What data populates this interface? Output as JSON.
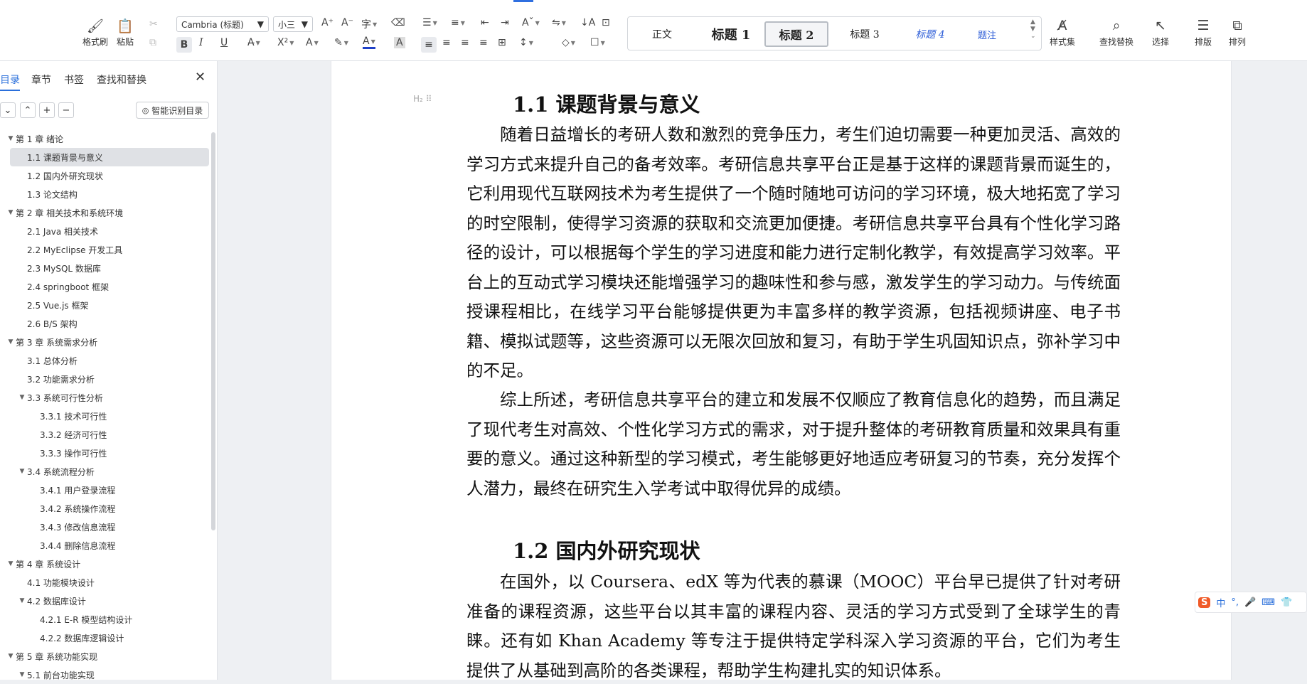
{
  "ribbon": {
    "format_painter": "格式刷",
    "paste": "粘贴",
    "font_name": "Cambria (标题)",
    "font_size": "小三",
    "styles": [
      "正文",
      "标题 1",
      "标题 2",
      "标题 3",
      "标题 4",
      "题注"
    ],
    "style_set": "样式集",
    "find_replace": "查找替换",
    "select": "选择",
    "layout": "排版",
    "arrange": "排列",
    "bold": "B",
    "italic": "I",
    "underline": "U",
    "clear": "A"
  },
  "sidebar": {
    "tabs": [
      "目录",
      "章节",
      "书签",
      "查找和替换"
    ],
    "smart_toc": "智能识别目录",
    "items": [
      {
        "label": "第 1 章  绪论",
        "level": 1,
        "toggle": "▼"
      },
      {
        "label": "1.1 课题背景与意义",
        "level": 2,
        "toggle": ""
      },
      {
        "label": "1.2 国内外研究现状",
        "level": 2,
        "toggle": ""
      },
      {
        "label": "1.3 论文结构",
        "level": 2,
        "toggle": ""
      },
      {
        "label": "第 2 章  相关技术和系统环境",
        "level": 1,
        "toggle": "▼"
      },
      {
        "label": "2.1 Java 相关技术",
        "level": 2,
        "toggle": ""
      },
      {
        "label": "2.2 MyEclipse 开发工具",
        "level": 2,
        "toggle": ""
      },
      {
        "label": "2.3 MySQL 数据库",
        "level": 2,
        "toggle": ""
      },
      {
        "label": "2.4 springboot 框架",
        "level": 2,
        "toggle": ""
      },
      {
        "label": "2.5 Vue.js 框架",
        "level": 2,
        "toggle": ""
      },
      {
        "label": "2.6 B/S 架构",
        "level": 2,
        "toggle": ""
      },
      {
        "label": "第 3 章  系统需求分析",
        "level": 1,
        "toggle": "▼"
      },
      {
        "label": "3.1 总体分析",
        "level": 2,
        "toggle": ""
      },
      {
        "label": "3.2 功能需求分析",
        "level": 2,
        "toggle": ""
      },
      {
        "label": "3.3  系统可行性分析",
        "level": 2,
        "toggle": "▼"
      },
      {
        "label": "3.3.1 技术可行性",
        "level": 3,
        "toggle": ""
      },
      {
        "label": "3.3.2 经济可行性",
        "level": 3,
        "toggle": ""
      },
      {
        "label": "3.3.3 操作可行性",
        "level": 3,
        "toggle": ""
      },
      {
        "label": "3.4 系统流程分析",
        "level": 2,
        "toggle": "▼"
      },
      {
        "label": "3.4.1  用户登录流程",
        "level": 3,
        "toggle": ""
      },
      {
        "label": "3.4.2  系统操作流程",
        "level": 3,
        "toggle": ""
      },
      {
        "label": "3.4.3 修改信息流程",
        "level": 3,
        "toggle": ""
      },
      {
        "label": "3.4.4 删除信息流程",
        "level": 3,
        "toggle": ""
      },
      {
        "label": "第 4 章  系统设计",
        "level": 1,
        "toggle": "▼"
      },
      {
        "label": "4.1  功能模块设计",
        "level": 2,
        "toggle": ""
      },
      {
        "label": "4.2  数据库设计",
        "level": 2,
        "toggle": "▼"
      },
      {
        "label": "4.2.1 E-R 模型结构设计",
        "level": 3,
        "toggle": ""
      },
      {
        "label": "4.2.2  数据库逻辑设计",
        "level": 3,
        "toggle": ""
      },
      {
        "label": "第 5 章  系统功能实现",
        "level": 1,
        "toggle": "▼"
      },
      {
        "label": "5.1 前台功能实现",
        "level": 2,
        "toggle": "▼"
      }
    ]
  },
  "document": {
    "h_mark": "H₂",
    "heading1": "1.1 课题背景与意义",
    "para1": "随着日益增长的考研人数和激烈的竞争压力，考生们迫切需要一种更加灵活、高效的学习方式来提升自己的备考效率。考研信息共享平台正是基于这样的课题背景而诞生的，它利用现代互联网技术为考生提供了一个随时随地可访问的学习环境，极大地拓宽了学习的时空限制，使得学习资源的获取和交流更加便捷。考研信息共享平台具有个性化学习路径的设计，可以根据每个学生的学习进度和能力进行定制化教学，有效提高学习效率。平台上的互动式学习模块还能增强学习的趣味性和参与感，激发学生的学习动力。与传统面授课程相比，在线学习平台能够提供更为丰富多样的教学资源，包括视频讲座、电子书籍、模拟试题等，这些资源可以无限次回放和复习，有助于学生巩固知识点，弥补学习中的不足。",
    "para2": "综上所述，考研信息共享平台的建立和发展不仅顺应了教育信息化的趋势，而且满足了现代考生对高效、个性化学习方式的需求，对于提升整体的考研教育质量和效果具有重要的意义。通过这种新型的学习模式，考生能够更好地适应考研复习的节奏，充分发挥个人潜力，最终在研究生入学考试中取得优异的成绩。",
    "heading2": "1.2 国内外研究现状",
    "para3": "在国外，以 Coursera、edX 等为代表的慕课（MOOC）平台早已提供了针对考研准备的课程资源，这些平台以其丰富的课程内容、灵活的学习方式受到了全球学生的青睐。还有如 Khan Academy 等专注于提供特定学科深入学习资源的平台，它们为考生提供了从基础到高阶的各类课程，帮助学生构建扎实的知识体系。"
  },
  "ime": {
    "label": "中"
  }
}
